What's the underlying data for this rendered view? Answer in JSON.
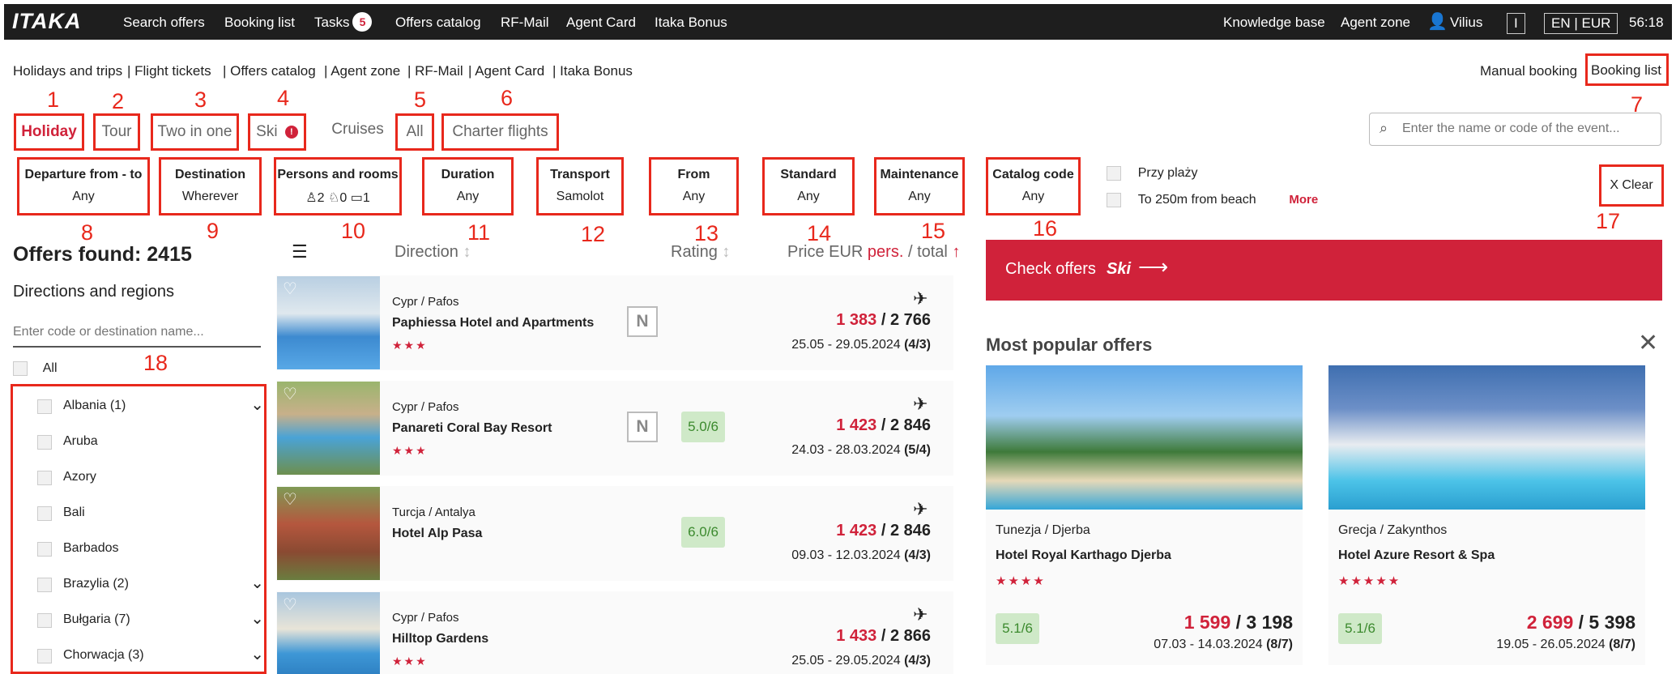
{
  "topbar": {
    "logo": "ITAKA",
    "nav": [
      "Search offers",
      "Booking list",
      "Tasks",
      "Offers catalog",
      "RF-Mail",
      "Agent Card",
      "Itaka Bonus"
    ],
    "tasks_count": "5",
    "right": {
      "knowledge_base": "Knowledge base",
      "agent_zone": "Agent zone",
      "user": "Vilius",
      "box1": "I",
      "lang": "EN | EUR",
      "timer": "56:18"
    }
  },
  "subnav": {
    "items": [
      "Holidays and trips",
      "| Flight tickets",
      "| Offers catalog",
      "| Agent zone",
      "| RF-Mail",
      "| Agent Card",
      "| Itaka Bonus"
    ],
    "manual_booking": "Manual booking",
    "sep": "|",
    "booking_list": "Booking list"
  },
  "tabs": {
    "holiday": "Holiday",
    "tour": "Tour",
    "two_in_one": "Two in one",
    "ski": "Ski",
    "cruises": "Cruises",
    "all": "All",
    "charter": "Charter flights"
  },
  "search": {
    "placeholder": "Enter the name or code of the event..."
  },
  "filters": {
    "departure": {
      "title": "Departure from - to",
      "value": "Any"
    },
    "destination": {
      "title": "Destination",
      "value": "Wherever"
    },
    "persons": {
      "title": "Persons and rooms",
      "adults": "2",
      "children": "0",
      "rooms": "1"
    },
    "duration": {
      "title": "Duration",
      "value": "Any"
    },
    "transport": {
      "title": "Transport",
      "value": "Samolot"
    },
    "from": {
      "title": "From",
      "value": "Any"
    },
    "standard": {
      "title": "Standard",
      "value": "Any"
    },
    "maintenance": {
      "title": "Maintenance",
      "value": "Any"
    },
    "catalog": {
      "title": "Catalog code",
      "value": "Any"
    },
    "beach1": "Przy plaży",
    "beach2": "To 250m from beach",
    "more": "More",
    "clear": "X Clear"
  },
  "annotations": [
    "1",
    "2",
    "3",
    "4",
    "5",
    "6",
    "7",
    "8",
    "9",
    "10",
    "11",
    "12",
    "13",
    "14",
    "15",
    "16",
    "17",
    "18"
  ],
  "results": {
    "offers_found": "Offers found: 2415",
    "regions_title": "Directions and regions",
    "region_placeholder": "Enter code or destination name...",
    "all_label": "All",
    "regions": [
      {
        "label": "Albania (1)",
        "expand": true
      },
      {
        "label": "Aruba",
        "expand": false
      },
      {
        "label": "Azory",
        "expand": false
      },
      {
        "label": "Bali",
        "expand": false
      },
      {
        "label": "Barbados",
        "expand": false
      },
      {
        "label": "Brazylia (2)",
        "expand": true
      },
      {
        "label": "Bułgaria (7)",
        "expand": true
      },
      {
        "label": "Chorwacja (3)",
        "expand": true
      }
    ]
  },
  "sort": {
    "direction": "Direction",
    "rating": "Rating",
    "price_prefix": "Price EUR",
    "price_pers": "pers.",
    "price_total": "/ total"
  },
  "offers": [
    {
      "loc": "Cypr / Pafos",
      "name": "Paphiessa Hotel and Apartments",
      "stars": "★★★",
      "badge": "N",
      "rating": "",
      "price_pers": "1 383",
      "price_total": " / 2 766",
      "dates": "25.05 - 29.05.2024",
      "dur": "(4/3)"
    },
    {
      "loc": "Cypr / Pafos",
      "name": "Panareti Coral Bay Resort",
      "stars": "★★★",
      "badge": "N",
      "rating": "5.0/6",
      "price_pers": "1 423",
      "price_total": " / 2 846",
      "dates": "24.03 - 28.03.2024",
      "dur": "(5/4)"
    },
    {
      "loc": "Turcja / Antalya",
      "name": "Hotel Alp Pasa",
      "stars": "",
      "badge": "",
      "rating": "6.0/6",
      "price_pers": "1 423",
      "price_total": " / 2 846",
      "dates": "09.03 - 12.03.2024",
      "dur": "(4/3)"
    },
    {
      "loc": "Cypr / Pafos",
      "name": "Hilltop Gardens",
      "stars": "★★★",
      "badge": "",
      "rating": "",
      "price_pers": "1 433",
      "price_total": " / 2 866",
      "dates": "25.05 - 29.05.2024",
      "dur": "(4/3)"
    }
  ],
  "check": {
    "label": "Check offers",
    "ski": "Ski"
  },
  "popular": {
    "title": "Most popular offers",
    "cards": [
      {
        "loc": "Tunezja / Djerba",
        "name": "Hotel Royal Karthago Djerba",
        "stars": "★★★★",
        "rating": "5.1/6",
        "price_pers": "1 599",
        "price_total": " / 3 198",
        "dates": "07.03 - 14.03.2024",
        "dur": "(8/7)"
      },
      {
        "loc": "Grecja / Zakynthos",
        "name": "Hotel Azure Resort & Spa",
        "stars": "★★★★★",
        "rating": "5.1/6",
        "price_pers": "2 699",
        "price_total": " / 5 398",
        "dates": "19.05 - 26.05.2024",
        "dur": "(8/7)"
      }
    ]
  },
  "colors": {
    "brand_red": "#d0223a",
    "annotation_red": "#e8281c",
    "topbar": "#1e1e1e",
    "rating_green": "#cfe9c8"
  }
}
